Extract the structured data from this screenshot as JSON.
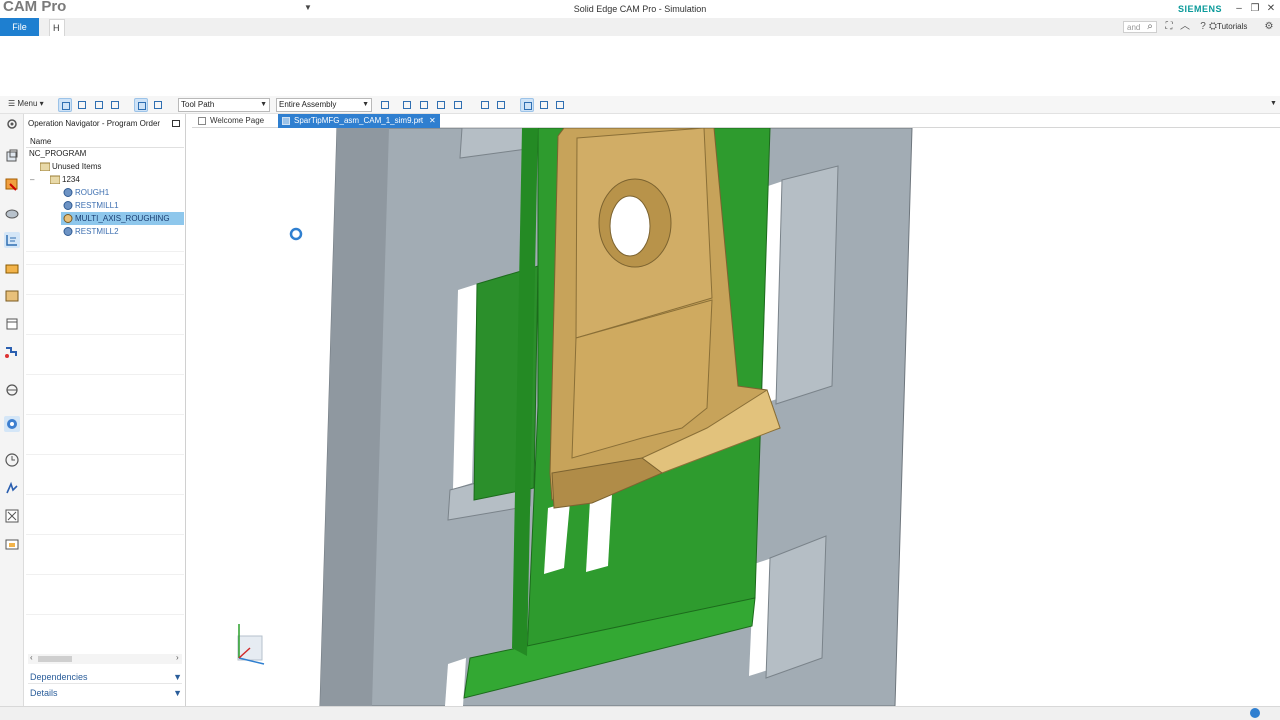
{
  "titlebar": {
    "app_logo": "CAM Pro",
    "window_title": "Solid Edge CAM Pro - Simulation",
    "brand": "SIEMENS"
  },
  "ribbon": {
    "file_tab": "File",
    "home_tab": "H",
    "search_text": "and",
    "tutorials_label": "Tutorials"
  },
  "toolbar": {
    "menu_label": "Menu",
    "filter_combo": "Tool Path",
    "scope_combo": "Entire Assembly"
  },
  "navigator": {
    "title": "Operation Navigator - Program Order",
    "column_name": "Name",
    "tree": [
      {
        "label": "NC_PROGRAM",
        "kind": "root"
      },
      {
        "label": "Unused Items",
        "kind": "folder"
      },
      {
        "label": "1234",
        "kind": "group"
      },
      {
        "label": "ROUGH1",
        "kind": "op"
      },
      {
        "label": "RESTMILL1",
        "kind": "op"
      },
      {
        "label": "MULTI_AXIS_ROUGHING",
        "kind": "op-selected"
      },
      {
        "label": "RESTMILL2",
        "kind": "op"
      }
    ],
    "dependencies_label": "Dependencies",
    "details_label": "Details"
  },
  "doc_tabs": {
    "welcome": "Welcome Page",
    "part": "SparTipMFG_asm_CAM_1_sim9.prt"
  },
  "colors": {
    "accent_blue": "#1e7fd0",
    "selection": "#8ec7ec",
    "fixture_gray": "#a3adb5",
    "fixture_green": "#2d9a2d",
    "part_gold": "#c9a55a"
  }
}
